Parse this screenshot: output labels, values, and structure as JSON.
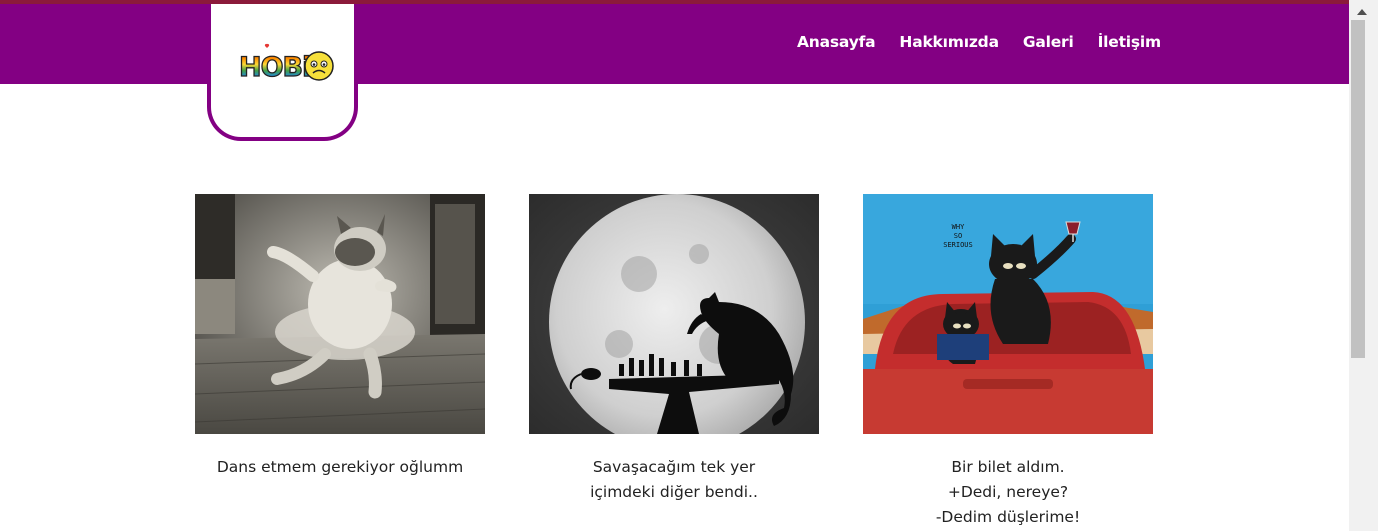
{
  "brand": {
    "logo_text": "HOBi",
    "primary_color": "#830083"
  },
  "nav": {
    "items": [
      {
        "label": "Anasayfa"
      },
      {
        "label": "Hakkımızda"
      },
      {
        "label": "Galeri"
      },
      {
        "label": "İletişim"
      }
    ]
  },
  "gallery": [
    {
      "image": "dancing-cat-tutu-photo",
      "caption": [
        "Dans etmem gerekiyor oğlumm"
      ]
    },
    {
      "image": "cat-chess-moon-silhouette",
      "caption": [
        "Savaşacağım tek yer",
        "içimdeki diğer bendi.."
      ]
    },
    {
      "image": "cats-red-car-painting",
      "painting_text": [
        "WHY",
        "SO",
        "SERIOUS"
      ],
      "caption": [
        "Bir bilet aldım.",
        "+Dedi, nereye?",
        "-Dedim düşlerime!"
      ]
    }
  ]
}
